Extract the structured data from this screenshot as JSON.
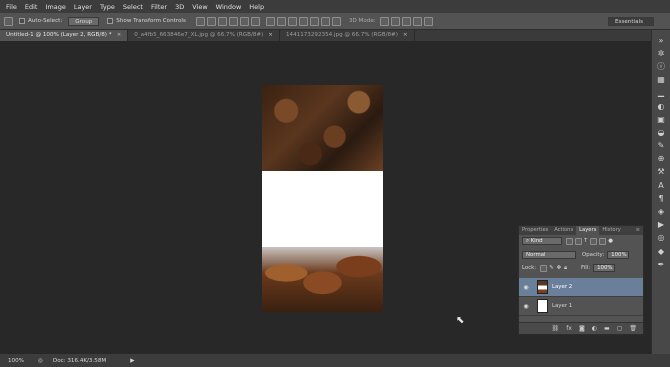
{
  "menu": [
    "File",
    "Edit",
    "Image",
    "Layer",
    "Type",
    "Select",
    "Filter",
    "3D",
    "View",
    "Window",
    "Help"
  ],
  "options": {
    "auto_select_label": "Auto-Select:",
    "auto_select_value": "Group",
    "transform_controls_label": "Show Transform Controls",
    "mode_label": "3D Mode:",
    "workspace": "Essentials"
  },
  "tabs": [
    {
      "label": "Untitled-1 @ 100% (Layer 2, RGB/8) *",
      "active": true
    },
    {
      "label": "0_a4fb5_663846e7_XL.jpg @ 66.7% (RGB/8#)",
      "active": false
    },
    {
      "label": "1441173292354.jpg @ 66.7% (RGB/8#)",
      "active": false
    }
  ],
  "status": {
    "zoom": "100%",
    "doc": "Doc: 316.4K/3.58M"
  },
  "panel": {
    "tabs": [
      "Properties",
      "Actions",
      "Layers",
      "History"
    ],
    "active_tab": "Layers",
    "filter_label": "Kind",
    "blend_mode": "Normal",
    "opacity_label": "Opacity:",
    "opacity_value": "100%",
    "lock_label": "Lock:",
    "fill_label": "Fill:",
    "fill_value": "100%",
    "layers": [
      {
        "name": "Layer 2",
        "selected": true
      },
      {
        "name": "Layer 1",
        "selected": false
      }
    ],
    "footer_icons": [
      "link-icon",
      "fx-icon",
      "mask-icon",
      "adjustment-icon",
      "folder-icon",
      "new-layer-icon",
      "trash-icon"
    ]
  },
  "colors": {
    "selected_layer": "#6a7f9a",
    "menubar": "#3c3c3c",
    "canvas_bg": "#282828"
  }
}
